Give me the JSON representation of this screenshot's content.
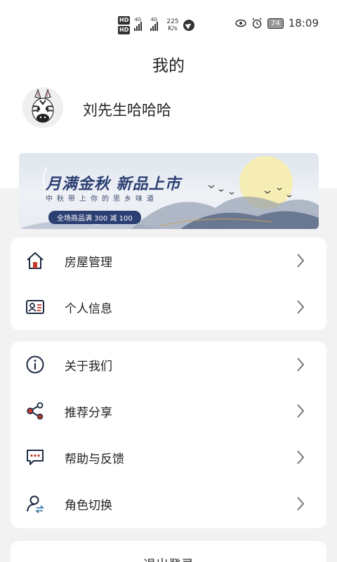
{
  "status_bar": {
    "hd1": "HD",
    "hd2": "HD",
    "net1": "4G",
    "net2": "4G",
    "speed_value": "225",
    "speed_unit": "K/s",
    "battery": "74",
    "time": "18:09"
  },
  "page": {
    "title": "我的"
  },
  "profile": {
    "username": "刘先生哈哈哈"
  },
  "banner": {
    "title": "月满金秋  新品上市",
    "subtitle": "中秋带上你的思乡味道",
    "promo": "全场商品满 300 减 100"
  },
  "menu_group_1": [
    {
      "label": "房屋管理",
      "icon": "house-icon"
    },
    {
      "label": "个人信息",
      "icon": "id-card-icon"
    }
  ],
  "menu_group_2": [
    {
      "label": "关于我们",
      "icon": "info-icon"
    },
    {
      "label": "推荐分享",
      "icon": "share-icon"
    },
    {
      "label": "帮助与反馈",
      "icon": "chat-icon"
    },
    {
      "label": "角色切换",
      "icon": "user-switch-icon"
    }
  ],
  "logout": {
    "label": "退出登录"
  },
  "colors": {
    "accent": "#c0392b",
    "banner_text": "#2c3f73",
    "icon_dark": "#1f2a44"
  }
}
